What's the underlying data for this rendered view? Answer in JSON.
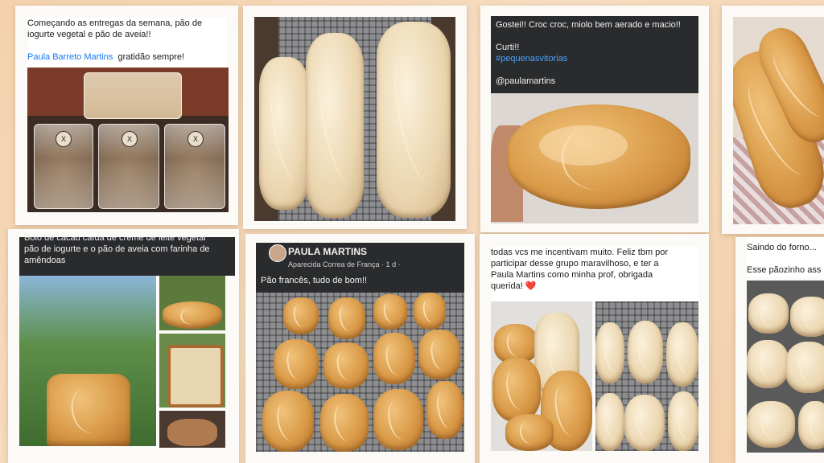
{
  "posts": {
    "entregas": {
      "line1": "Começando as entregas da semana, pão de",
      "line2": "iogurte vegetal e pão de aveia!!",
      "mention": "Paula Barreto Martins",
      "thanks": "gratidão sempre!"
    },
    "croc": {
      "line1": "Gostei!! Croc croc, miolo bem aerado e macio!!",
      "line2": "Curti!!",
      "hashtag": "#pequenasvitorias",
      "handle": "@paulamartins"
    },
    "bolo": {
      "line1": "Bolo de cacau caída de creme  de leite vegetal",
      "line2": "pão de iogurte e o pão de aveia  com farinha de",
      "line3": "amêndoas"
    },
    "paes": {
      "name": "PAULA MARTINS",
      "meta": "Aparecida Correa de França · 1 d ·",
      "text": "Pão francês,  tudo de bom!!"
    },
    "incentivo": {
      "line1": "todas vcs me incentivam muito. Feliz tbm por",
      "line2": "participar desse grupo maravilhoso, e ter a",
      "line3": "Paula Martins como minha prof, obrigada",
      "line4": "querida!",
      "heart": "❤️"
    },
    "forno": {
      "line1": "Saindo do forno...",
      "line2": "Esse pãozinho ass"
    }
  }
}
